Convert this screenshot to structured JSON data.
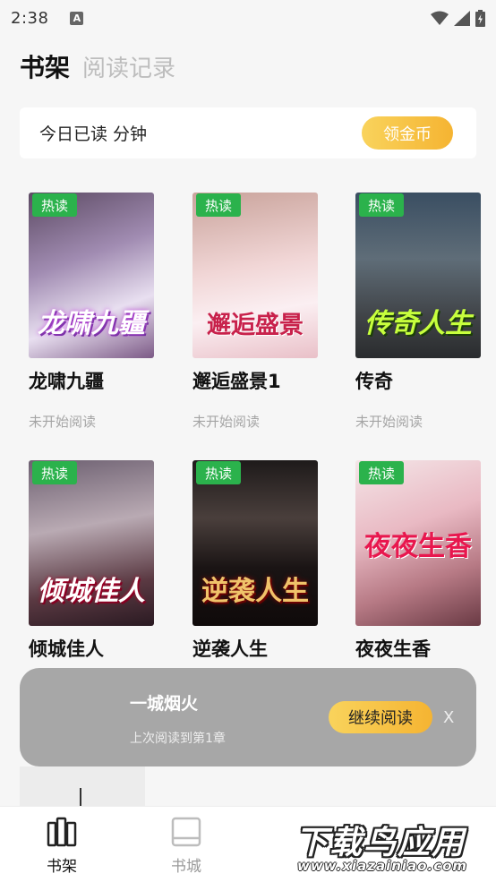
{
  "status_bar": {
    "time": "2:38",
    "notification_glyph": "A"
  },
  "header": {
    "tab_shelf": "书架",
    "tab_history": "阅读记录"
  },
  "today": {
    "text": "今日已读  分钟",
    "coin_button": "领金币"
  },
  "hot_tag": "热读",
  "books": [
    {
      "title": "龙啸九疆",
      "cover_text": "龙啸九疆",
      "status": "未开始阅读"
    },
    {
      "title": "邂逅盛景1",
      "cover_text": "邂逅盛景",
      "status": "未开始阅读"
    },
    {
      "title": "传奇",
      "cover_text": "传奇人生",
      "status": "未开始阅读"
    },
    {
      "title": "倾城佳人",
      "cover_text": "倾城佳人"
    },
    {
      "title": "逆袭人生",
      "cover_text": "逆袭人生"
    },
    {
      "title": "夜夜生香",
      "cover_text": "夜夜生香"
    }
  ],
  "continue_reading": {
    "title": "一城烟火",
    "subtitle": "上次阅读到第1章",
    "button": "继续阅读",
    "close": "X"
  },
  "bottom_nav": [
    {
      "label": "书架",
      "icon": "bookshelf-icon"
    },
    {
      "label": "书城",
      "icon": "book-icon"
    }
  ],
  "watermark": {
    "main": "下载鸟应用",
    "sub": "www.xiazainiao.com"
  }
}
